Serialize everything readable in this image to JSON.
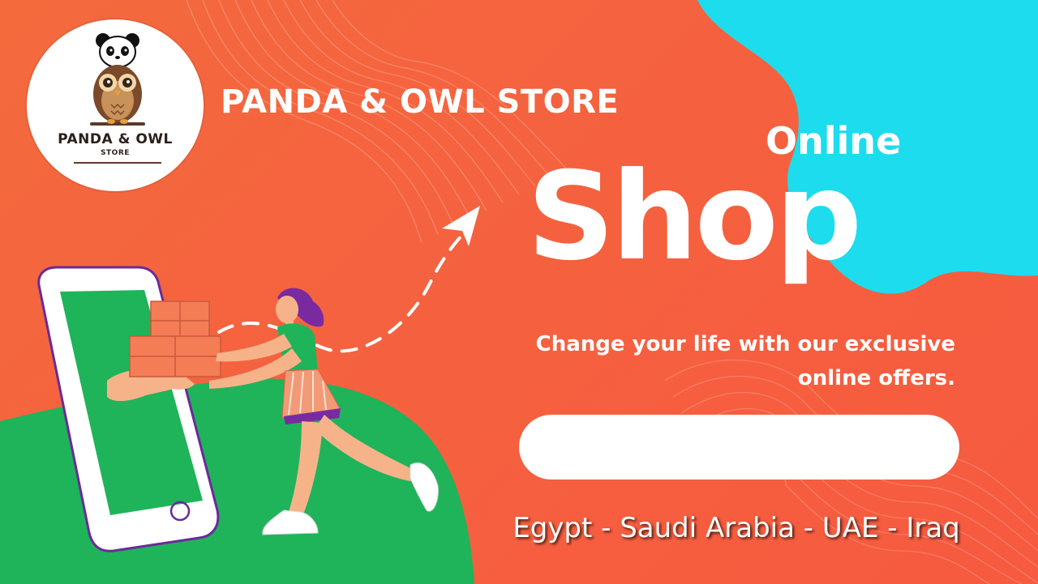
{
  "brand": {
    "logo_name": "PANDA & OWL",
    "logo_sub": "STORE",
    "title": "PANDA & OWL STORE"
  },
  "hero": {
    "online_label": "Online",
    "shop_label": "Shop",
    "tagline_line1": "Change your life with our exclusive",
    "tagline_line2": "online offers."
  },
  "search": {
    "value": "",
    "placeholder": ""
  },
  "footer": {
    "countries": "Egypt - Saudi Arabia - UAE - Iraq"
  },
  "colors": {
    "background": "#f5623f",
    "accent_cyan": "#1ddcee",
    "hill_green": "#1fb35a",
    "white": "#ffffff"
  },
  "icons": {
    "logo": "panda-owl-logo-icon",
    "phone": "smartphone-icon",
    "parcel": "parcel-box-icon",
    "arrow": "dashed-arrow-icon",
    "courier": "delivery-person-illustration"
  }
}
